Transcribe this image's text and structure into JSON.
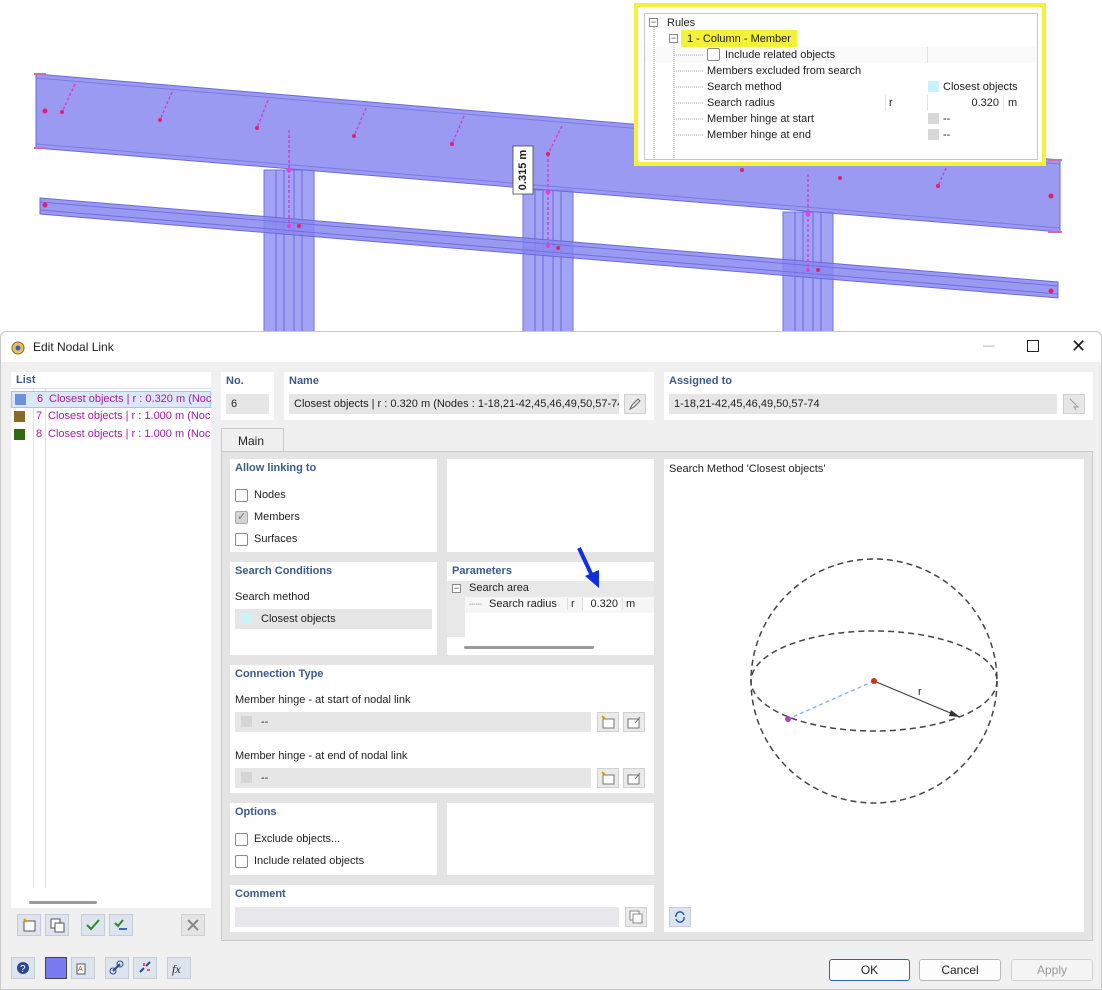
{
  "viewport": {
    "dimension_label": "0.315 m"
  },
  "rules_popup": {
    "root_label": "Rules",
    "rule_label": "1 - Column - Member",
    "rows": [
      {
        "label": "Include related objects",
        "value": "",
        "unit": "",
        "symbol": ""
      },
      {
        "label": "Members excluded from search",
        "value": "",
        "unit": "",
        "symbol": ""
      },
      {
        "label": "Search method",
        "value": "Closest objects",
        "unit": "",
        "symbol": ""
      },
      {
        "label": "Search radius",
        "value": "0.320",
        "unit": "m",
        "symbol": "r"
      },
      {
        "label": "Member hinge at start",
        "value": "--",
        "unit": "",
        "symbol": ""
      },
      {
        "label": "Member hinge at end",
        "value": "--",
        "unit": "",
        "symbol": ""
      }
    ],
    "highlight_color": "#f4f13a",
    "closest_swatch_color": "#c8f4f8"
  },
  "dialog": {
    "title": "Edit Nodal Link",
    "list": {
      "header": "List",
      "items": [
        {
          "no": "6",
          "text": "Closest objects | r : 0.320 m (Noc",
          "color": "#6f8fe0"
        },
        {
          "no": "7",
          "text": "Closest objects | r : 1.000 m (Noc",
          "color": "#8a6a2a"
        },
        {
          "no": "8",
          "text": "Closest objects | r : 1.000 m (Noc",
          "color": "#2f6a10"
        }
      ]
    },
    "no": {
      "label": "No.",
      "value": "6"
    },
    "name": {
      "label": "Name",
      "value": "Closest objects | r : 0.320 m (Nodes : 1-18,21-42,45,46,49,50,57-74"
    },
    "assigned": {
      "label": "Assigned to",
      "value": "1-18,21-42,45,46,49,50,57-74"
    },
    "tab_main": "Main",
    "allow_linking": {
      "title": "Allow linking to",
      "nodes": "Nodes",
      "members": "Members",
      "surfaces": "Surfaces"
    },
    "search_conditions": {
      "title": "Search Conditions",
      "method_label": "Search method",
      "method_value": "Closest objects"
    },
    "parameters": {
      "title": "Parameters",
      "group": "Search area",
      "radius_label": "Search radius",
      "radius_symbol": "r",
      "radius_value": "0.320",
      "radius_unit": "m"
    },
    "connection_type": {
      "title": "Connection Type",
      "start_label": "Member hinge - at start of nodal link",
      "start_value": "--",
      "end_label": "Member hinge - at end of nodal link",
      "end_value": "--"
    },
    "options": {
      "title": "Options",
      "exclude": "Exclude objects...",
      "include_related": "Include related objects"
    },
    "comment": {
      "title": "Comment",
      "value": ""
    },
    "preview": {
      "title": "Search Method 'Closest objects'",
      "radius_symbol": "r"
    },
    "buttons": {
      "ok": "OK",
      "cancel": "Cancel",
      "apply": "Apply"
    }
  }
}
